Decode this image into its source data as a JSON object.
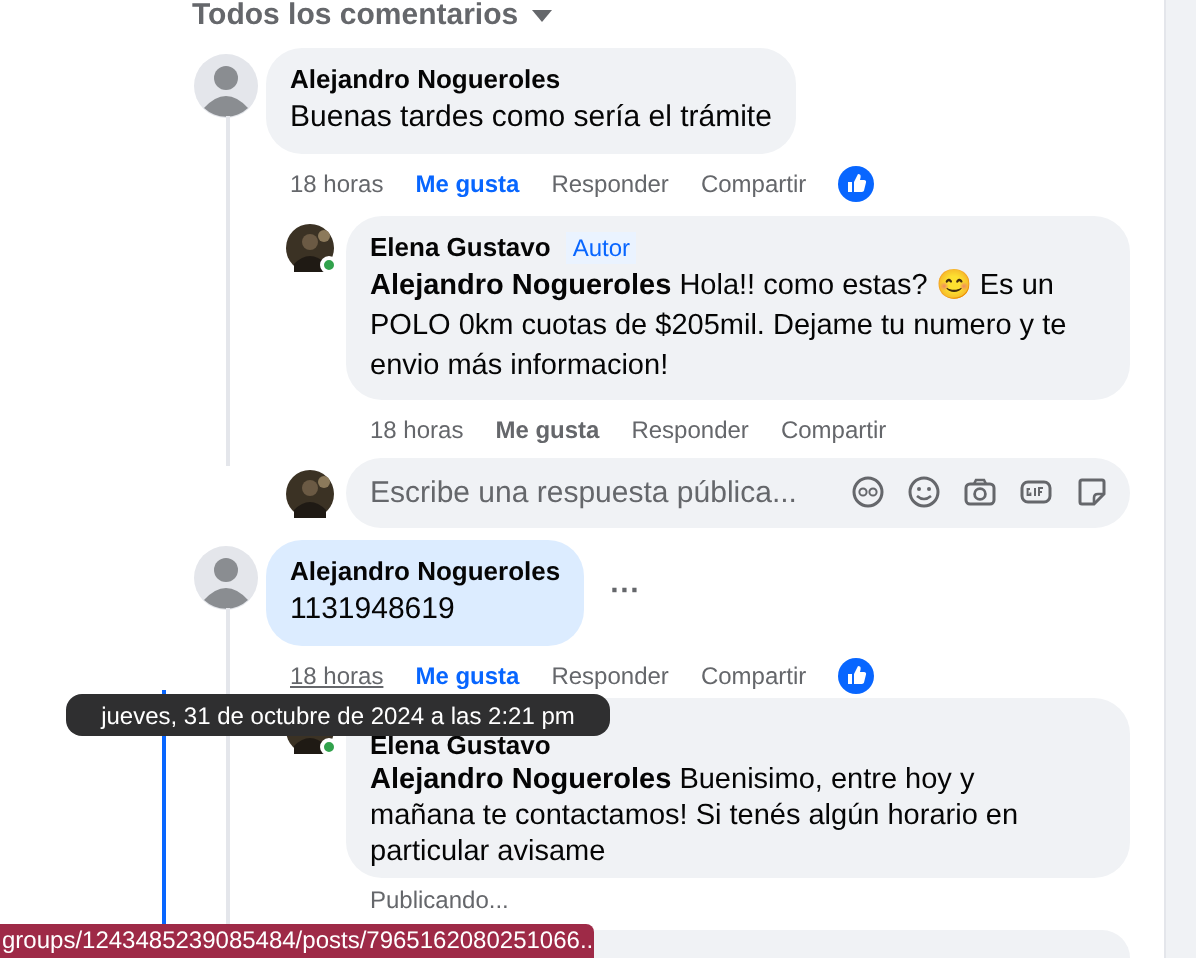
{
  "header": {
    "title": "Todos los comentarios"
  },
  "comments": [
    {
      "author": "Alejandro Nogueroles",
      "text": "Buenas tardes como sería el trámite",
      "highlighted": false,
      "time": "18 horas",
      "time_hovered": false,
      "like": "Me gusta",
      "liked": true,
      "reply": "Responder",
      "share": "Compartir",
      "reaction": true,
      "replies": [
        {
          "kind": "posted",
          "author": "Elena Gustavo",
          "badge": "Autor",
          "online": true,
          "text": "**Alejandro Nogueroles** Hola!! como estas? 😊 Es un POLO 0km cuotas de $205mil. Dejame tu numero y te envio más informacion!",
          "time": "18 horas",
          "like": "Me gusta",
          "liked": false,
          "reply": "Responder",
          "share": "Compartir"
        }
      ],
      "reply_field": {
        "placeholder": "Escribe una respuesta pública..."
      }
    },
    {
      "author": "Alejandro Nogueroles",
      "text": "1131948619",
      "highlighted": true,
      "more": "···",
      "time": "18 horas",
      "time_hovered": true,
      "like": "Me gusta",
      "liked": true,
      "reply": "Responder",
      "share": "Compartir",
      "reaction": true,
      "replies": [
        {
          "kind": "pending",
          "author": "Elena Gustavo",
          "online": true,
          "text": "**Alejandro Nogueroles** Buenisimo, entre hoy y mañana te contactamos! Si tenés algún horario en particular avisame",
          "status": "Publicando..."
        }
      ]
    }
  ],
  "tooltip": {
    "text": "jueves, 31 de octubre de 2024 a las 2:21 pm"
  },
  "status_bar": {
    "url": "groups/1243485239085484/posts/7965162080251066..."
  }
}
